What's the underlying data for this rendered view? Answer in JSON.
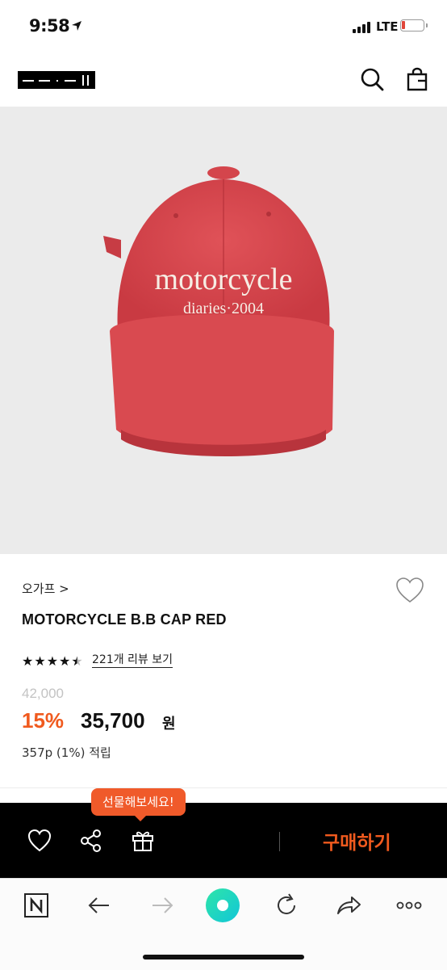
{
  "status_bar": {
    "time": "9:58",
    "network": "LTE"
  },
  "product": {
    "image_text_line1": "motorcycle",
    "image_text_line2": "diaries·2004",
    "brand": "오가프 >",
    "name": "MOTORCYCLE B.B CAP RED",
    "rating_stars": 4.5,
    "review_link": "221개 리뷰 보기",
    "original_price": "42,000",
    "discount": "15%",
    "price": "35,700",
    "currency": "원",
    "points": "357p (1%) 적립"
  },
  "action_bar": {
    "gift_tooltip": "선물해보세요!",
    "buy_label": "구매하기",
    "icons": [
      "heart-icon",
      "share-icon",
      "gift-icon"
    ]
  },
  "browser_toolbar": {
    "icons": [
      "naver-icon",
      "back-icon",
      "forward-icon",
      "home-icon",
      "refresh-icon",
      "share-icon",
      "more-icon"
    ]
  },
  "colors": {
    "accent": "#f05a1e",
    "tooltip": "#f05a2a",
    "cap_red": "#d9434a",
    "action_bar_bg": "#000000",
    "image_bg": "#ebebeb"
  }
}
